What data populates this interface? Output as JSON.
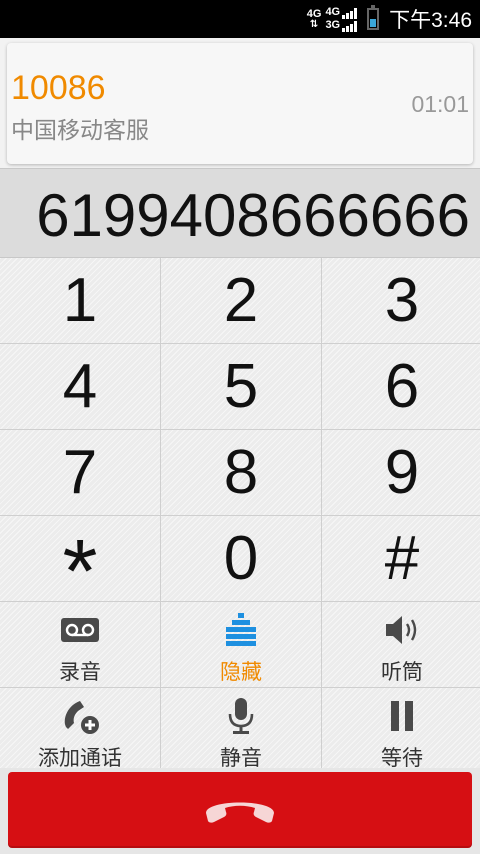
{
  "status_bar": {
    "network_1": "4G",
    "network_2_top": "4G",
    "network_2_bottom": "3G",
    "time": "下午3:46"
  },
  "call": {
    "number": "10086",
    "name": "中国移动客服",
    "duration": "01:01"
  },
  "dialed_digits": "6199408666666",
  "keypad": {
    "keys": [
      "1",
      "2",
      "3",
      "4",
      "5",
      "6",
      "7",
      "8",
      "9",
      "*",
      "0",
      "#"
    ]
  },
  "actions": {
    "record": "录音",
    "hide_keypad": "隐藏",
    "speaker": "听筒",
    "add_call": "添加通话",
    "mute": "静音",
    "hold": "等待"
  },
  "colors": {
    "accent": "#f08a00",
    "end_call": "#d60f13",
    "icon_blue": "#1e90e0",
    "icon_gray": "#4a4a4a"
  },
  "icons": {
    "record": "voicemail-tape-icon",
    "hide_keypad": "dialpad-grid-icon",
    "speaker": "speaker-icon",
    "add_call": "phone-add-icon",
    "mute": "microphone-icon",
    "hold": "pause-icon",
    "end_call": "phone-hangup-icon"
  }
}
